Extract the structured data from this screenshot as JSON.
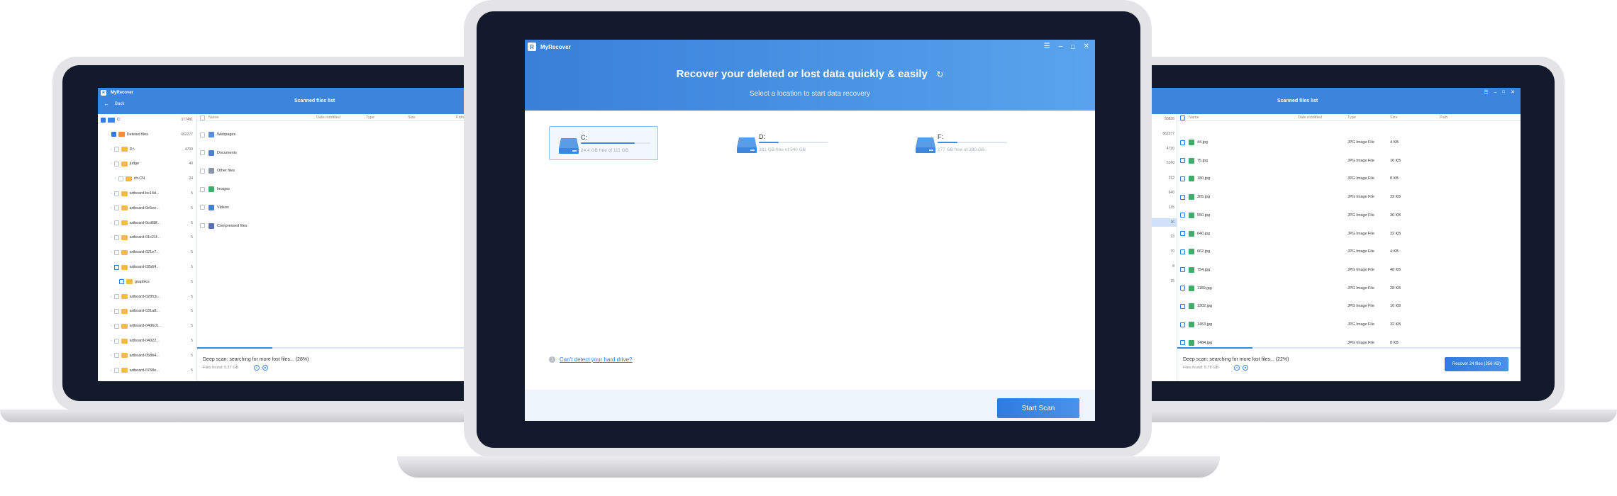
{
  "app": {
    "name": "MyRecover",
    "logo_glyph": "R",
    "accent": "#3b86dc"
  },
  "left_window": {
    "back_label": "Back",
    "title": "Scanned files list",
    "tree": [
      {
        "label": "C:",
        "count": "377481"
      },
      {
        "label": "Deleted files",
        "count": "662277"
      },
      {
        "label": "D:\\",
        "count": "4730"
      },
      {
        "label": "judge",
        "count": "40"
      },
      {
        "label": "zh-CN",
        "count": "24"
      },
      {
        "label": "artboard-bc14d...",
        "count": "5"
      },
      {
        "label": "artboard-0e5ee...",
        "count": "5"
      },
      {
        "label": "artboard-0cd68f...",
        "count": "5"
      },
      {
        "label": "artboard-01c21f...",
        "count": "5"
      },
      {
        "label": "artboard-021e7...",
        "count": "5"
      },
      {
        "label": "artboard-02b64...",
        "count": "5"
      },
      {
        "label": "graphics",
        "count": "5"
      },
      {
        "label": "artboard-028fcb...",
        "count": "5"
      },
      {
        "label": "artboard-031a8...",
        "count": "5"
      },
      {
        "label": "artboard-0406c0...",
        "count": "5"
      },
      {
        "label": "artboard-04022...",
        "count": "5"
      },
      {
        "label": "artboard-058b4...",
        "count": "5"
      },
      {
        "label": "artboard-0768e...",
        "count": "5"
      }
    ],
    "columns": [
      "Name",
      "Date modified",
      "Type",
      "Size",
      "Path"
    ],
    "rows": [
      "Webpages",
      "Documents",
      "Other files",
      "Images",
      "Videos",
      "Compressed files"
    ],
    "scan_status": "Deep scan: searching for more lost files... (28%)",
    "files_found": "Files found: 5.37 GB",
    "progress": 0.28
  },
  "center_window": {
    "headline": "Recover your deleted or lost data quickly & easily",
    "subtitle": "Select a location to start data recovery",
    "drives": [
      {
        "name": "C:",
        "free": "24.4 GB free of 111 GB",
        "used": 0.78,
        "selected": true
      },
      {
        "name": "D:",
        "free": "381 GB free of 540 GB",
        "used": 0.29,
        "selected": false
      },
      {
        "name": "F:",
        "free": "277 GB free of 390 GB",
        "used": 0.29,
        "selected": false
      }
    ],
    "help_link": "Can't detect your hard drive?",
    "start_button": "Start Scan"
  },
  "right_window": {
    "title": "Scanned files list",
    "columns": [
      "Name",
      "Date modified",
      "Type",
      "Size",
      "Path"
    ],
    "tree_counts": [
      "93836",
      "662277",
      "4730",
      "5160",
      "323",
      "640",
      "135",
      "36",
      "23",
      "70",
      "8",
      "15"
    ],
    "rows": [
      {
        "name": "44.jpg",
        "type": "JPG Image File",
        "size": "4 KB"
      },
      {
        "name": "75.jpg",
        "type": "JPG Image File",
        "size": "16 KB"
      },
      {
        "name": "180.jpg",
        "type": "JPG Image File",
        "size": "8 KB"
      },
      {
        "name": "305.jpg",
        "type": "JPG Image File",
        "size": "32 KB"
      },
      {
        "name": "550.jpg",
        "type": "JPG Image File",
        "size": "36 KB"
      },
      {
        "name": "640.jpg",
        "type": "JPG Image File",
        "size": "32 KB"
      },
      {
        "name": "662.jpg",
        "type": "JPG Image File",
        "size": "4 KB"
      },
      {
        "name": "754.jpg",
        "type": "JPG Image File",
        "size": "48 KB"
      },
      {
        "name": "1189.jpg",
        "type": "JPG Image File",
        "size": "28 KB"
      },
      {
        "name": "1302.jpg",
        "type": "JPG Image File",
        "size": "16 KB"
      },
      {
        "name": "1453.jpg",
        "type": "JPG Image File",
        "size": "32 KB"
      },
      {
        "name": "1484.jpg",
        "type": "JPG Image File",
        "size": "8 KB"
      }
    ],
    "scan_status": "Deep scan: searching for more lost files... (22%)",
    "files_found": "Files found: 5.76 GB",
    "recover_button": "Recover 24 files (356 KB)",
    "progress": 0.22
  }
}
